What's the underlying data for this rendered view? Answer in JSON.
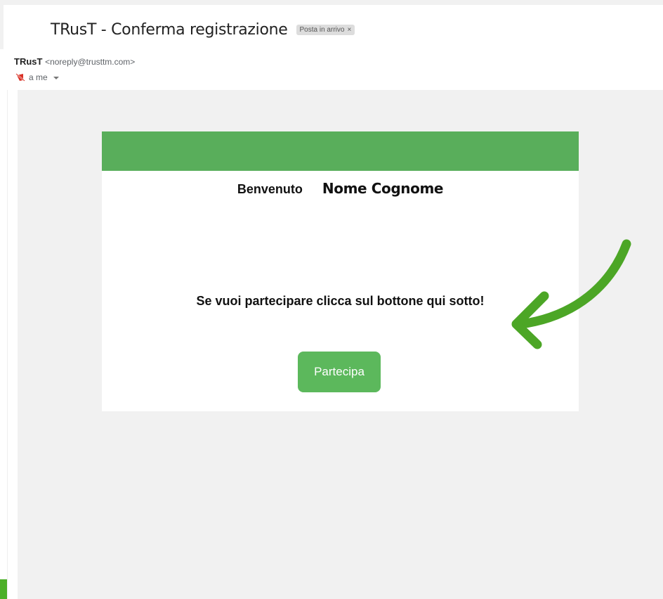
{
  "email": {
    "subject": "TRusT - Conferma registrazione",
    "label_chip": "Posta in arrivo",
    "label_remove": "×",
    "sender_name": "TRusT",
    "sender_email": "<noreply@trusttm.com>",
    "recipient": "a me"
  },
  "message": {
    "welcome": "Benvenuto",
    "fullname": "Nome Cognome",
    "cta_text": "Se vuoi partecipare clicca sul bottone qui sotto!",
    "button_label": "Partecipa"
  },
  "colors": {
    "header_green": "#59ae5b",
    "button_green": "#5cb85c",
    "arrow_green": "#4ca626",
    "body_bg": "#f1f1f1"
  },
  "icons": {
    "recipient_icon": "no-image-icon",
    "recipient_caret": "caret-down-icon",
    "annotation": "curved-arrow-icon"
  }
}
